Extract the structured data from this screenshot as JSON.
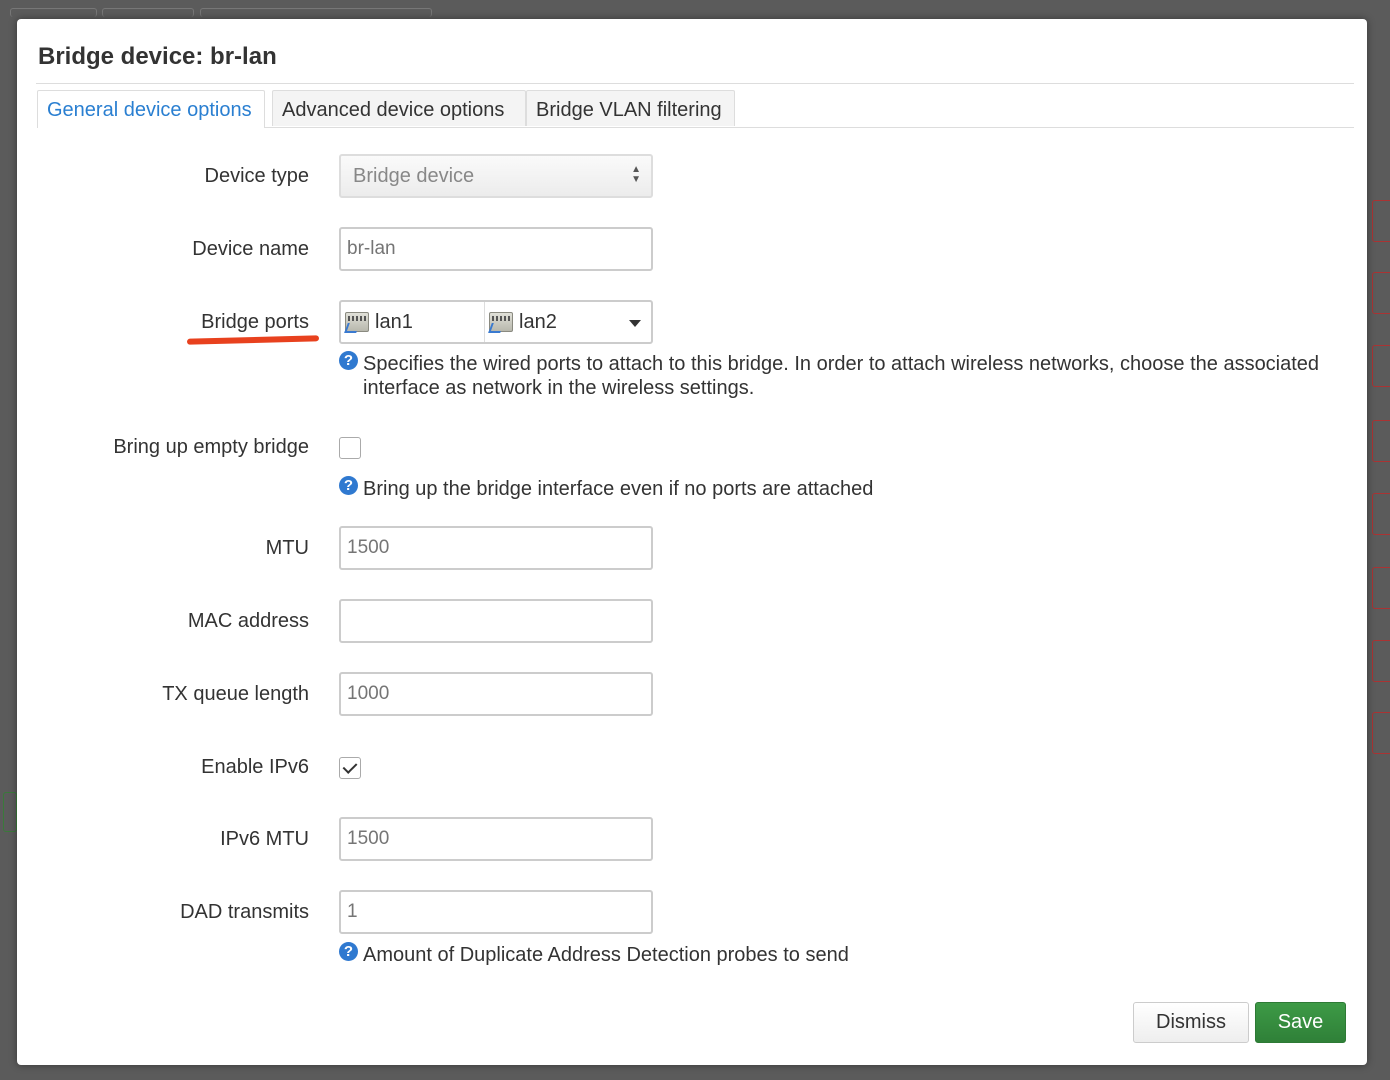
{
  "modal": {
    "title": "Bridge device: br-lan",
    "tabs": [
      {
        "label": "General device options",
        "active": true
      },
      {
        "label": "Advanced device options",
        "active": false
      },
      {
        "label": "Bridge VLAN filtering",
        "active": false
      }
    ]
  },
  "form": {
    "device_type": {
      "label": "Device type",
      "value": "Bridge device"
    },
    "device_name": {
      "label": "Device name",
      "placeholder": "br-lan",
      "value": ""
    },
    "bridge_ports": {
      "label": "Bridge ports",
      "ports": [
        "lan1",
        "lan2"
      ],
      "help": "Specifies the wired ports to attach to this bridge. In order to attach wireless networks, choose the associated interface as network in the wireless settings."
    },
    "empty_bridge": {
      "label": "Bring up empty bridge",
      "checked": false,
      "help": "Bring up the bridge interface even if no ports are attached"
    },
    "mtu": {
      "label": "MTU",
      "placeholder": "1500"
    },
    "mac_address": {
      "label": "MAC address",
      "placeholder": ""
    },
    "tx_queue": {
      "label": "TX queue length",
      "placeholder": "1000"
    },
    "enable_ipv6": {
      "label": "Enable IPv6",
      "checked": true
    },
    "ipv6_mtu": {
      "label": "IPv6 MTU",
      "placeholder": "1500"
    },
    "dad_transmits": {
      "label": "DAD transmits",
      "placeholder": "1",
      "help": "Amount of Duplicate Address Detection probes to send"
    }
  },
  "help_icon_glyph": "?",
  "buttons": {
    "dismiss": "Dismiss",
    "save": "Save"
  },
  "colors": {
    "accent": "#2a7fd1",
    "save": "#358c3e",
    "annotation": "#e8411e"
  }
}
